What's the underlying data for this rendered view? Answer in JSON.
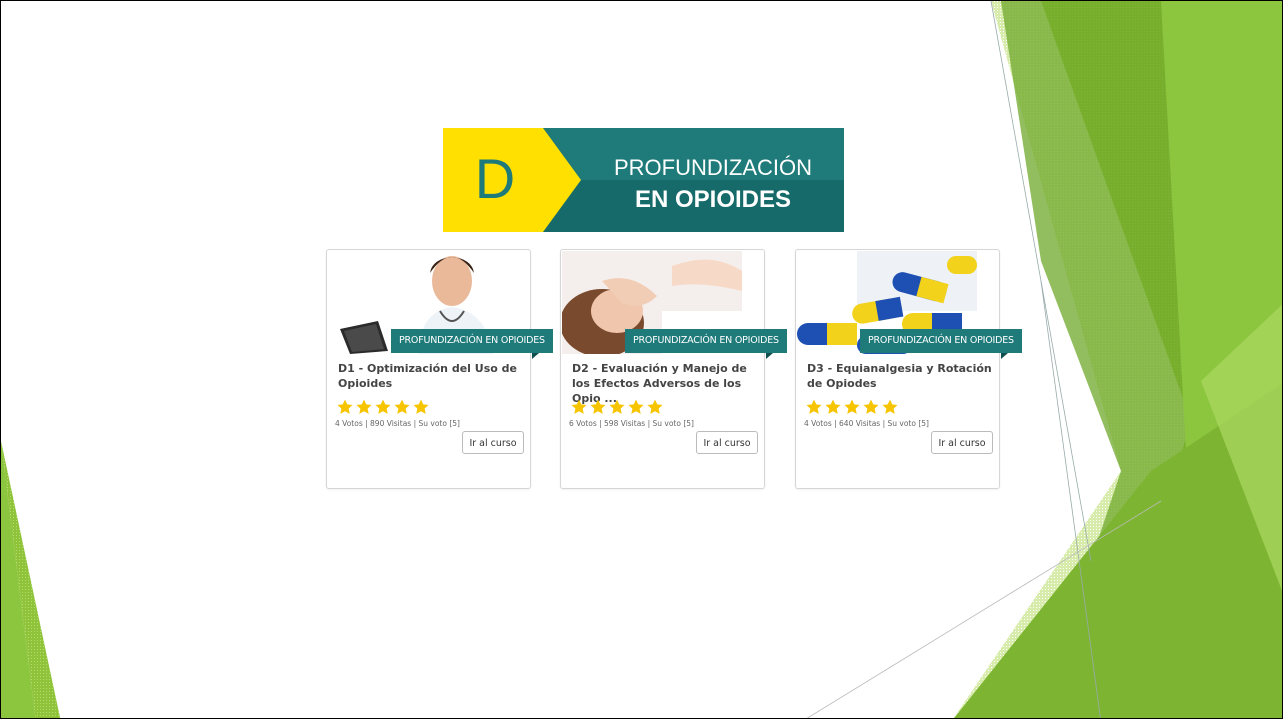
{
  "banner": {
    "letter": "D",
    "line1": "PROFUNDIZACIÓN",
    "line2": "EN OPIOIDES"
  },
  "courses": [
    {
      "category": "PROFUNDIZACIÓN EN OPIOIDES",
      "title": "D1 - Optimización del Uso de Opioides",
      "rating": 5,
      "meta": "4 Votos | 890 Visitas | Su voto [5]",
      "button": "Ir al curso",
      "image": "doctor-tablet-photo"
    },
    {
      "category": "PROFUNDIZACIÓN EN OPIOIDES",
      "title": "D2 - Evaluación y Manejo de los Efectos Adversos de los Opio ...",
      "rating": 5,
      "meta": "6 Votos | 598 Visitas | Su voto [5]",
      "button": "Ir al curso",
      "image": "patient-headache-photo"
    },
    {
      "category": "PROFUNDIZACIÓN EN OPIOIDES",
      "title": "D3 - Equianalgesia y Rotación de Opiodes",
      "rating": 5,
      "meta": "4 Votos | 640 Visitas | Su voto [5]",
      "button": "Ir al curso",
      "image": "capsules-photo"
    }
  ],
  "colors": {
    "teal": "#1f7a7a",
    "yellow": "#ffe000",
    "green": "#8cc63f",
    "star": "#f6c500"
  }
}
